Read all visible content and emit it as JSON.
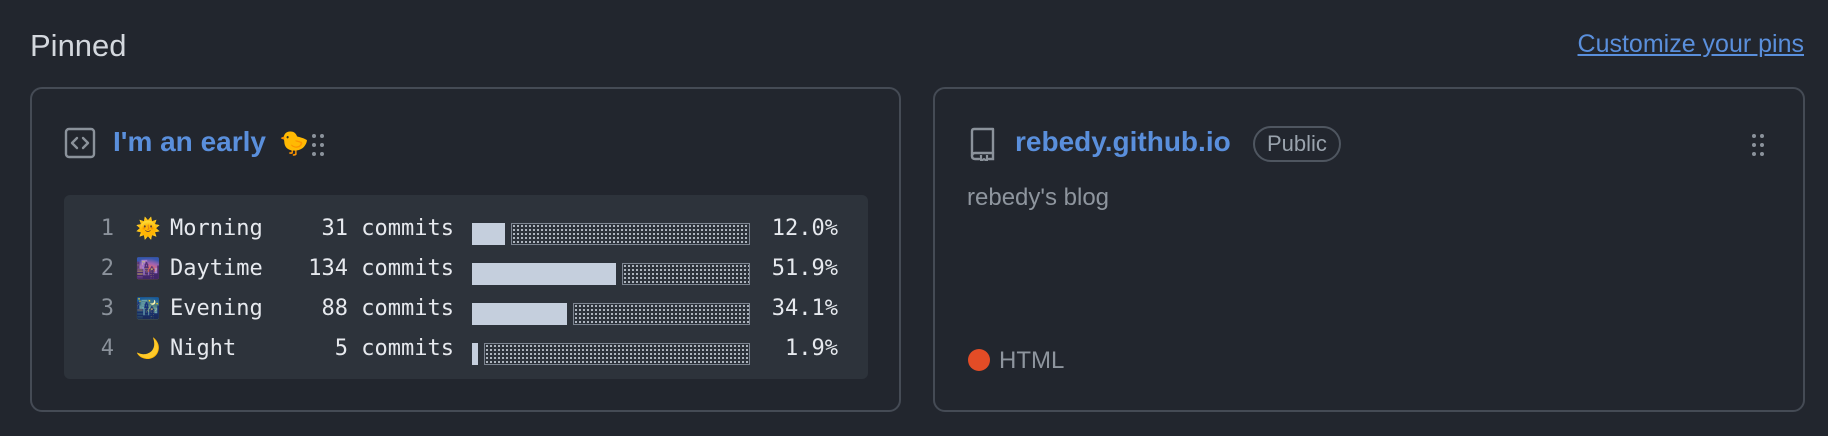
{
  "header": {
    "title": "Pinned",
    "customize_label": "Customize your pins"
  },
  "gist_card": {
    "title": "I'm an early",
    "title_emoji": "🐤",
    "icon": "code-square-icon",
    "rows": [
      {
        "num": "1",
        "emoji": "🌞",
        "period": "Morning",
        "commits": "31 commits",
        "pct": "12.0%",
        "fraction": 0.12
      },
      {
        "num": "2",
        "emoji": "🌆",
        "period": "Daytime",
        "commits": "134 commits",
        "pct": "51.9%",
        "fraction": 0.519
      },
      {
        "num": "3",
        "emoji": "🌃",
        "period": "Evening",
        "commits": "88 commits",
        "pct": "34.1%",
        "fraction": 0.341
      },
      {
        "num": "4",
        "emoji": "🌙",
        "period": "Night",
        "commits": "5 commits",
        "pct": "1.9%",
        "fraction": 0.019
      }
    ]
  },
  "repo_card": {
    "name": "rebedy.github.io",
    "visibility": "Public",
    "description": "rebedy's blog",
    "icon": "repo-book-icon",
    "language": "HTML",
    "language_color": "#e34c26"
  },
  "colors": {
    "background": "#22262e",
    "link": "#5a8fdc",
    "border": "#454b55"
  }
}
